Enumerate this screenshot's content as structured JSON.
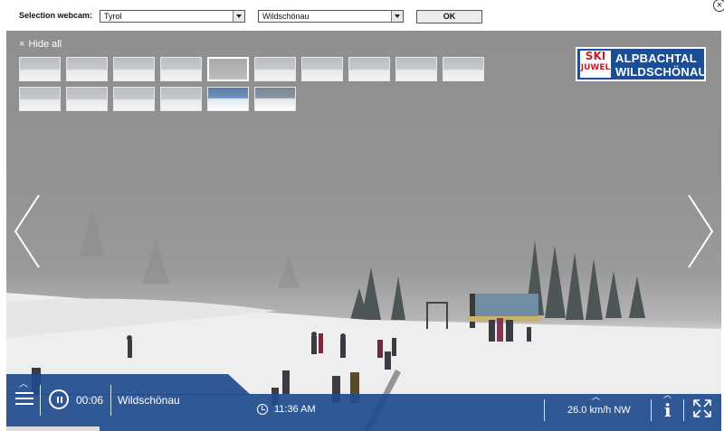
{
  "toolbar": {
    "selection_label": "Selection webcam:",
    "region_value": "Tyrol",
    "location_value": "Wildschönau",
    "ok_label": "OK",
    "close_symbol": "×"
  },
  "webcam": {
    "hide_all_label": "Hide all",
    "hide_all_icon": "×",
    "logo": {
      "ski_line1": "SKI",
      "ski_line2": "JUWEL",
      "line1": "ALPBACHTAL",
      "line2": "WILDSCHÖNAU"
    },
    "thumbnails_row1_count": 10,
    "thumbnails_row2_count": 6
  },
  "player": {
    "elapsed": "00:06",
    "location": "Wildschönau",
    "time": "11:36 AM",
    "wind": "26.0 km/h NW",
    "info_label": "i",
    "progress_fraction": 0.13
  },
  "colors": {
    "bar": "#204b8c",
    "logo_blue": "#1b4e96",
    "logo_red": "#c41e2c"
  }
}
